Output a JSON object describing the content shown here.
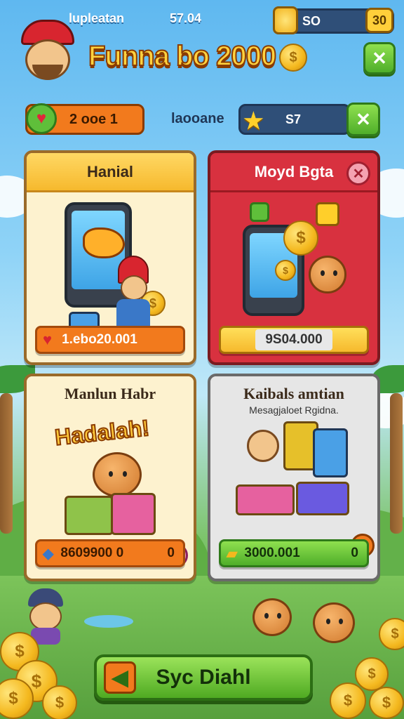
{
  "header": {
    "left_label": "lupleatan",
    "left_value": "57.04",
    "gold_value": "SO",
    "gold_badge": "30",
    "title": "Funna bo 2000",
    "stat_label": "laooane",
    "stat_value": "S7",
    "hearts_value": "2 ooe 1"
  },
  "cards": [
    {
      "title": "Hanial",
      "price": "1.ebo20.001"
    },
    {
      "title": "Moyd Bgta",
      "price": "9S04.000"
    },
    {
      "title": "Manlun Habr",
      "banner": "Hadalah!",
      "price": "8609900 0",
      "price_right": "0"
    },
    {
      "title": "Kaibals amtian",
      "subtitle": "Mesagjaloet Rgidna.",
      "price": "3000.001",
      "price_right": "0"
    }
  ],
  "footer": {
    "button_label": "Syc Diahl"
  },
  "colors": {
    "sky": "#5fb8f0",
    "accent_green": "#4fae2a",
    "gold": "#f4b81e",
    "card_red": "#d8313f",
    "card_cream": "#fdf2cf",
    "price_orange": "#f27a1d"
  },
  "icons": [
    "heart-icon",
    "star-icon",
    "close-icon",
    "gold-icon",
    "coin-icon",
    "arrow-icon",
    "gem-icon"
  ]
}
